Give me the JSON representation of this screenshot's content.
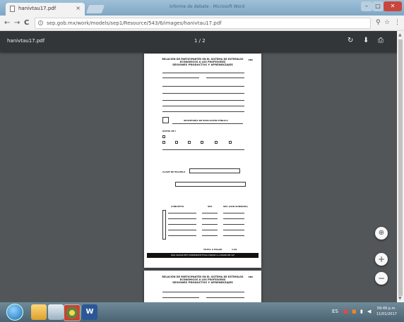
{
  "browser": {
    "tab_title": "hanivtau17.pdf",
    "tab_close": "×",
    "window_title": "Informe de debate - Microsoft Word",
    "minimize": "–",
    "maximize": "□",
    "close": "✕",
    "url": "sep.gob.mx/work/models/sep1/Resource/543/6/images/hanivtau17.pdf",
    "back": "←",
    "forward": "→",
    "reload": "C",
    "zoom_icon": "⚲",
    "star_icon": "☆",
    "menu_icon": "⋮"
  },
  "pdf_toolbar": {
    "file_name": "hanivtau17.pdf",
    "page_indicator": "1 / 2",
    "rotate_icon": "↻",
    "download_icon": "⬇",
    "print_icon": "⎙"
  },
  "document": {
    "header_line1": "RELACIÓN DE PARTICIPANTES EN EL SISTEMA DE ESTÍMULOS ECONÓMICOS A LOS PROFESORES",
    "header_line2": "SESIONES PRODUCTOS Y APRENDIZAJES",
    "code": "SPA",
    "sec_label": "SECRETARÍA DE EDUCACIÓN PÚBLICA",
    "datos_label": "DATOS DE I",
    "clave_label": "CLAVE DE ESCUELA",
    "conc_header": "CONCEPTO",
    "spa_header": "SPA",
    "spa2_header": "SPA (CON SUBSIDIO)",
    "total_label": "TOTAL A PAGAR",
    "total_value": "1.00",
    "footer_bar": "PARA VALIDAR ESTE COMPROBANTE FISCAL DIRIJASE A LA PÁGINA DEL SAT"
  },
  "zoom": {
    "fit": "⊕",
    "zoom_in": "+",
    "zoom_out": "−"
  },
  "taskbar": {
    "time": "09:49 p.m.",
    "date": "11/01/2017",
    "lang": "ES"
  }
}
